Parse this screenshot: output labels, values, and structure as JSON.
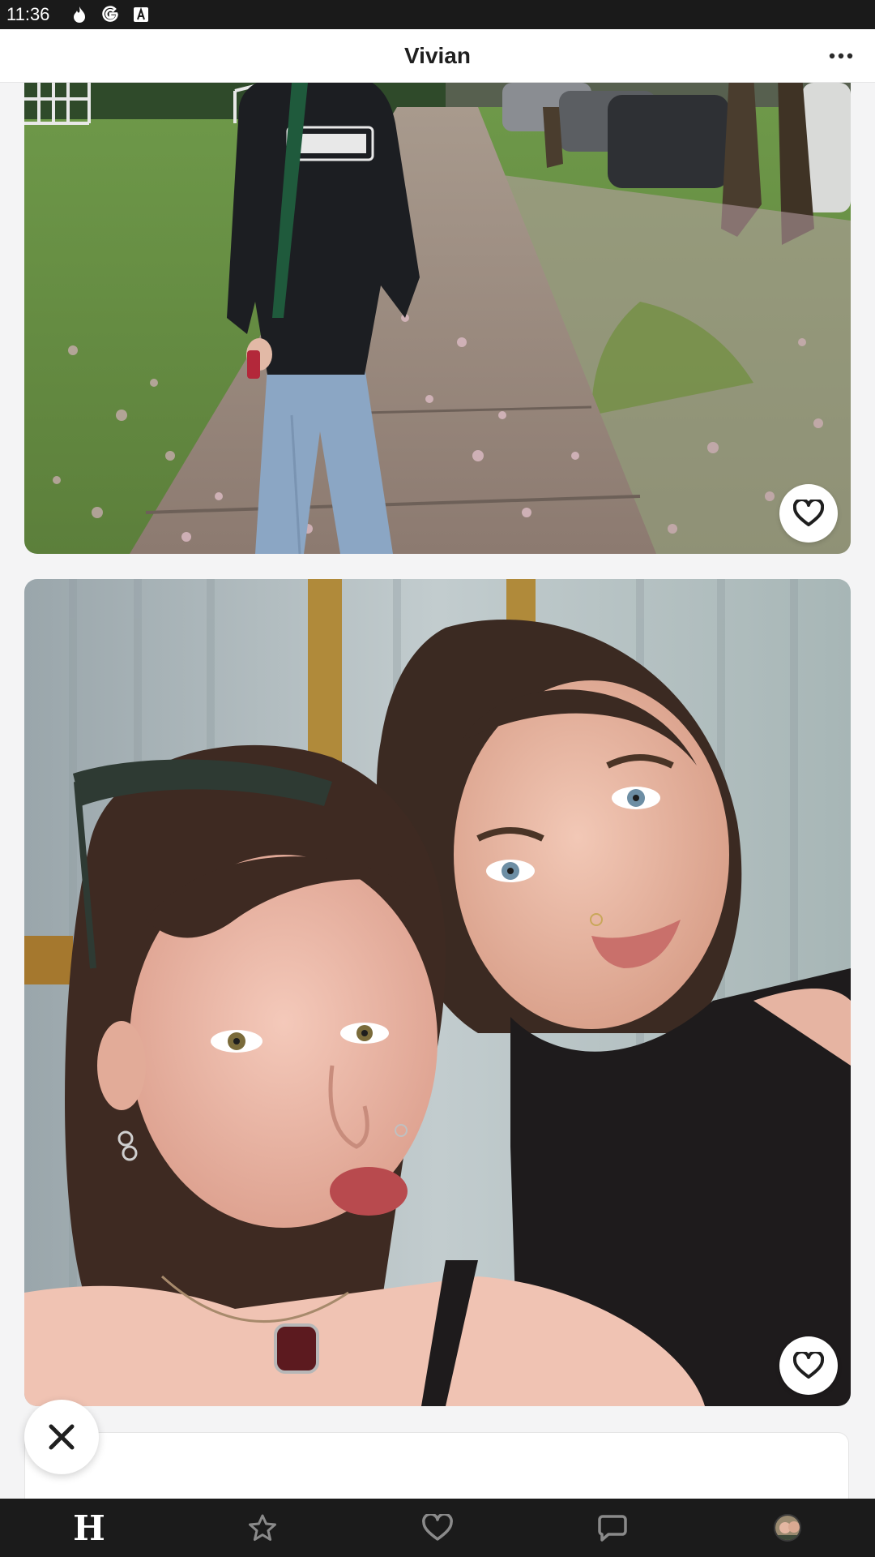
{
  "status_bar": {
    "time": "11:36",
    "icons": [
      "flame-icon",
      "google-icon",
      "font-a-icon"
    ]
  },
  "header": {
    "title": "Vivian",
    "menu_icon": "more-horizontal-icon"
  },
  "photos": [
    {
      "like_icon": "heart-outline-icon"
    },
    {
      "like_icon": "heart-outline-icon"
    }
  ],
  "skip_icon": "close-x-icon",
  "bottom_nav": {
    "items": [
      {
        "icon": "hinge-logo-icon",
        "label": "H"
      },
      {
        "icon": "star-icon"
      },
      {
        "icon": "heart-icon"
      },
      {
        "icon": "chat-bubble-icon"
      },
      {
        "icon": "profile-avatar-icon"
      }
    ]
  }
}
